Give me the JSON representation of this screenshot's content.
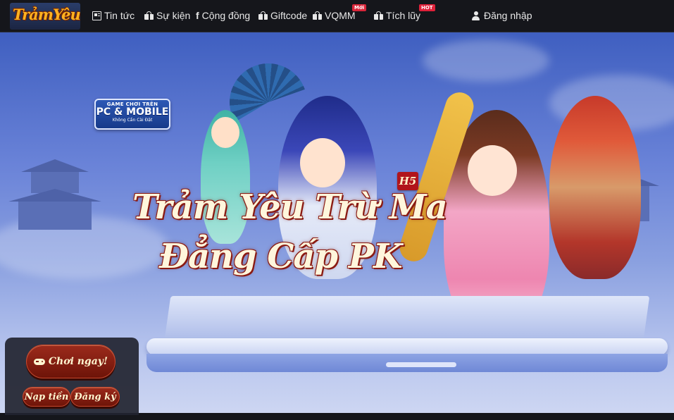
{
  "site": {
    "logo_text": "TrảmYêu"
  },
  "nav": {
    "items": [
      {
        "label": "Tin tức",
        "icon": "newspaper-icon"
      },
      {
        "label": "Sự kiện",
        "icon": "gift-icon"
      },
      {
        "label": "Cộng đồng",
        "icon": "facebook-icon",
        "icon_glyph": "f"
      },
      {
        "label": "Giftcode",
        "icon": "gift-icon"
      },
      {
        "label": "VQMM",
        "icon": "gift-icon",
        "badge": "Mới"
      },
      {
        "label": "Tích lũy",
        "icon": "gift-icon",
        "badge": "HOT"
      }
    ],
    "login_label": "Đăng nhập"
  },
  "hero": {
    "platform_badge": {
      "line1": "GAME CHƠI TRÊN",
      "line2": "PC & MOBILE",
      "line3": "Không Cần Cài Đặt"
    },
    "h5_tag": "H5",
    "title_line1": "Trảm Yêu Trừ Ma",
    "title_line2": "Đẳng Cấp PK"
  },
  "cta": {
    "play_label": "Chơi ngay!",
    "topup_label": "Nạp tiền",
    "register_label": "Đăng ký"
  },
  "colors": {
    "nav_bg": "#15161b",
    "accent_gold": "#ffb321",
    "badge_red": "#d9263a",
    "button_red": "#9b2a1c"
  }
}
